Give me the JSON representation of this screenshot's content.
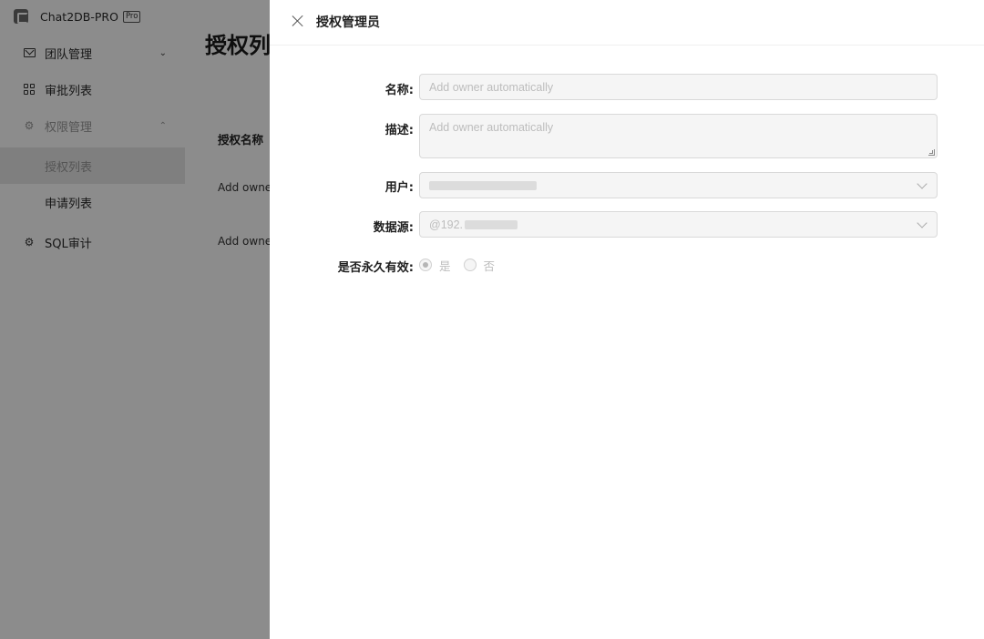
{
  "app": {
    "brand_name": "Chat2DB-PRO",
    "brand_tag": "Pro",
    "page_title": "授权列",
    "table": {
      "header": "授权名称",
      "rows": [
        "Add owne",
        "Add owne"
      ]
    },
    "sidebar": {
      "items": [
        {
          "label": "团队管理",
          "icon": "mail-icon"
        },
        {
          "label": "审批列表",
          "icon": "grid-icon"
        },
        {
          "label": "权限管理",
          "icon": "gear-icon"
        },
        {
          "label": "授权列表"
        },
        {
          "label": "申请列表"
        },
        {
          "label": "SQL审计",
          "icon": "gear-icon"
        }
      ]
    }
  },
  "drawer": {
    "title": "授权管理员",
    "form": {
      "name": {
        "label": "名称:",
        "placeholder": "Add owner automatically"
      },
      "description": {
        "label": "描述:",
        "placeholder": "Add owner automatically"
      },
      "user": {
        "label": "用户:"
      },
      "datasource": {
        "label": "数据源:",
        "value": "@192."
      },
      "permanent": {
        "label": "是否永久有效:",
        "options": [
          {
            "label": "是",
            "checked": true
          },
          {
            "label": "否",
            "checked": false
          }
        ]
      }
    }
  },
  "colors": {
    "overlay": "#737373",
    "field_bg": "#f5f5f5",
    "field_border": "#d9d9d9",
    "placeholder": "#bdbdbd"
  }
}
